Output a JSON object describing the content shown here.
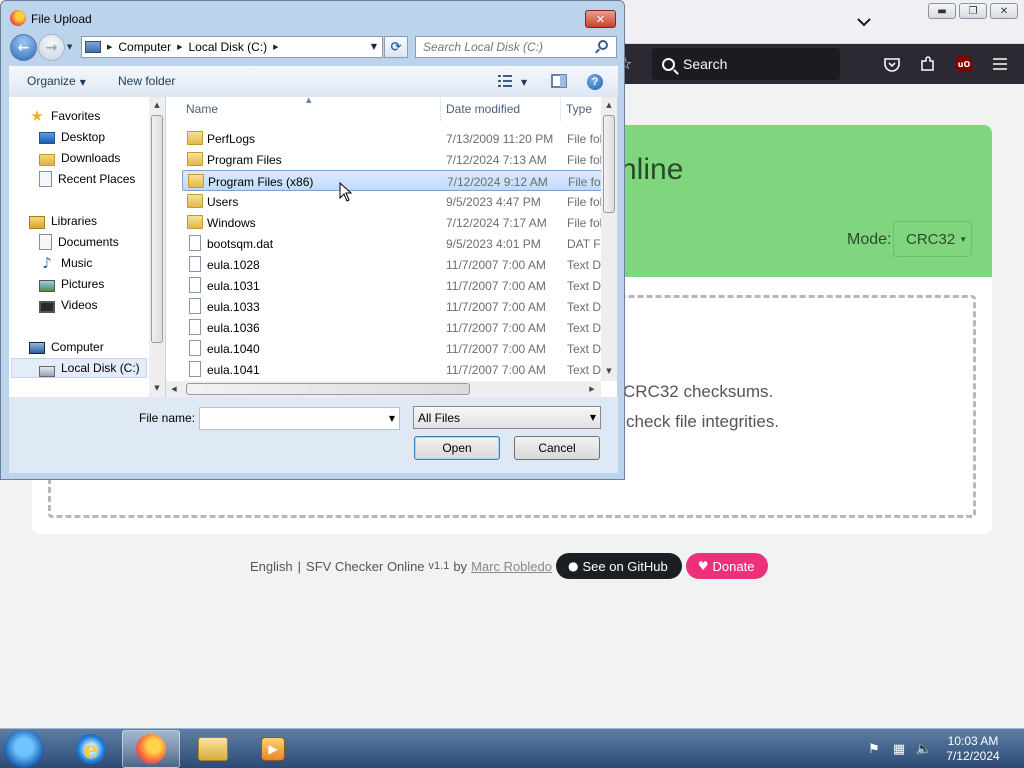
{
  "browser": {
    "search_placeholder": "Search"
  },
  "page": {
    "title_fragment": "nline",
    "mode_label": "Mode:",
    "mode_value": "CRC32",
    "drop_line1": "CRC32 checksums.",
    "drop_line2": "check file integrities.",
    "footer_lang": "English",
    "footer_sep": "|",
    "footer_app": "SFV Checker Online",
    "footer_version": "v1.1",
    "footer_by": "by",
    "footer_author": "Marc Robledo",
    "github_label": "See on GitHub",
    "donate_label": "Donate",
    "colors": {
      "header_green": "#7fd67f",
      "github_pill": "#1b1f23",
      "donate_pill": "#ee2f7a"
    }
  },
  "dialog": {
    "title": "File Upload",
    "address": [
      "Computer",
      "Local Disk (C:)"
    ],
    "search_placeholder": "Search Local Disk (C:)",
    "toolbar": {
      "organize": "Organize",
      "new_folder": "New folder"
    },
    "nav": {
      "favorites_header": "Favorites",
      "favorites": [
        "Desktop",
        "Downloads",
        "Recent Places"
      ],
      "libraries_header": "Libraries",
      "libraries": [
        "Documents",
        "Music",
        "Pictures",
        "Videos"
      ],
      "computer_header": "Computer",
      "selected_drive": "Local Disk (C:)"
    },
    "columns": {
      "name": "Name",
      "date": "Date modified",
      "type": "Type"
    },
    "files": [
      {
        "name": "PerfLogs",
        "date": "7/13/2009 11:20 PM",
        "type": "File fol",
        "kind": "folder"
      },
      {
        "name": "Program Files",
        "date": "7/12/2024 7:13 AM",
        "type": "File fol",
        "kind": "folder"
      },
      {
        "name": "Program Files (x86)",
        "date": "7/12/2024 9:12 AM",
        "type": "File fol",
        "kind": "folder",
        "selected": true
      },
      {
        "name": "Users",
        "date": "9/5/2023 4:47 PM",
        "type": "File fol",
        "kind": "folder"
      },
      {
        "name": "Windows",
        "date": "7/12/2024 7:17 AM",
        "type": "File fol",
        "kind": "folder"
      },
      {
        "name": "bootsqm.dat",
        "date": "9/5/2023 4:01 PM",
        "type": "DAT Fi",
        "kind": "file"
      },
      {
        "name": "eula.1028",
        "date": "11/7/2007 7:00 AM",
        "type": "Text D",
        "kind": "file"
      },
      {
        "name": "eula.1031",
        "date": "11/7/2007 7:00 AM",
        "type": "Text D",
        "kind": "file"
      },
      {
        "name": "eula.1033",
        "date": "11/7/2007 7:00 AM",
        "type": "Text D",
        "kind": "file"
      },
      {
        "name": "eula.1036",
        "date": "11/7/2007 7:00 AM",
        "type": "Text D",
        "kind": "file"
      },
      {
        "name": "eula.1040",
        "date": "11/7/2007 7:00 AM",
        "type": "Text D",
        "kind": "file"
      },
      {
        "name": "eula.1041",
        "date": "11/7/2007 7:00 AM",
        "type": "Text D",
        "kind": "file"
      }
    ],
    "file_name_label": "File name:",
    "file_name_value": "",
    "filter_value": "All Files",
    "open_label": "Open",
    "cancel_label": "Cancel"
  },
  "taskbar": {
    "time": "10:03 AM",
    "date": "7/12/2024"
  }
}
